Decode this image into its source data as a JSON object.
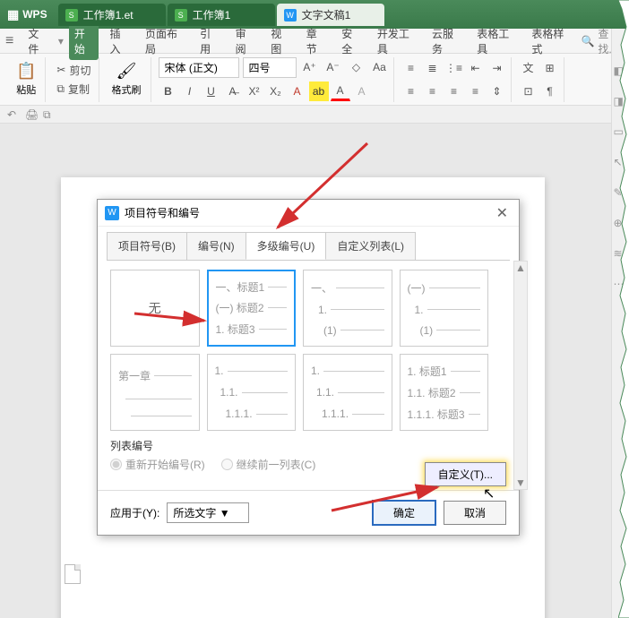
{
  "app": {
    "name": "WPS"
  },
  "docTabs": [
    {
      "label": "工作簿1.et",
      "active": false
    },
    {
      "label": "工作簿1",
      "active": false
    },
    {
      "label": "文字文稿1",
      "active": true
    }
  ],
  "menu": {
    "hamburger": "≡",
    "file": "文件",
    "items": [
      "开始",
      "插入",
      "页面布局",
      "引用",
      "审阅",
      "视图",
      "章节",
      "安全",
      "开发工具",
      "云服务",
      "表格工具",
      "表格样式"
    ],
    "activeIndex": 0,
    "search": "查找..."
  },
  "toolbar": {
    "paste": "粘贴",
    "cut": "剪切",
    "copy": "复制",
    "formatPainter": "格式刷",
    "fontName": "宋体 (正文)",
    "fontSize": "四号"
  },
  "dialog": {
    "title": "项目符号和编号",
    "tabs": [
      "项目符号(B)",
      "编号(N)",
      "多级编号(U)",
      "自定义列表(L)"
    ],
    "activeTab": 2,
    "noneLabel": "无",
    "row1": [
      {
        "l1": "一、标题1",
        "l2": "(一) 标题2",
        "l3": "1. 标题3"
      },
      {
        "l1": "一、",
        "l2": "1.",
        "l3": "(1)"
      },
      {
        "l1": "(一)",
        "l2": "1.",
        "l3": "(1)"
      }
    ],
    "row2": [
      {
        "l1": "第一章",
        "l2": "",
        "l3": ""
      },
      {
        "l1": "1.",
        "l2": "1.1.",
        "l3": "1.1.1."
      },
      {
        "l1": "1.",
        "l2": "1.1.",
        "l3": "1.1.1."
      },
      {
        "l1": "1. 标题1",
        "l2": "1.1. 标题2",
        "l3": "1.1.1. 标题3"
      }
    ],
    "listNumberLabel": "列表编号",
    "restart": "重新开始编号(R)",
    "continue": "继续前一列表(C)",
    "customBtn": "自定义(T)...",
    "applyToLabel": "应用于(Y):",
    "applyToValue": "所选文字",
    "ok": "确定",
    "cancel": "取消"
  }
}
